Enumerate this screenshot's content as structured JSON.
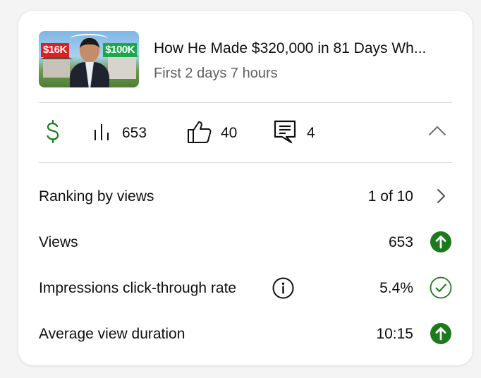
{
  "video": {
    "thumbnail_left_tag": "$16K",
    "thumbnail_right_tag": "$100K",
    "title": "How He Made $320,000 in 81 Days Wh...",
    "subtitle": "First 2 days 7 hours"
  },
  "stats": {
    "revenue_icon": "dollar-icon",
    "views_icon": "bar-chart-icon",
    "views": "653",
    "likes_icon": "thumbs-up-icon",
    "likes": "40",
    "comments_icon": "comment-icon",
    "comments": "4",
    "collapse_icon": "chevron-up-icon"
  },
  "metrics": [
    {
      "label": "Ranking by views",
      "value": "1 of 10",
      "indicator": "chevron-right-icon"
    },
    {
      "label": "Views",
      "value": "653",
      "indicator": "up-arrow-icon"
    },
    {
      "label": "Impressions click-through rate",
      "value": "5.4%",
      "indicator": "check-circle-icon",
      "info_icon": "info-icon"
    },
    {
      "label": "Average view duration",
      "value": "10:15",
      "indicator": "up-arrow-icon"
    }
  ],
  "colors": {
    "accent_green": "#1b7a1b",
    "text_primary": "#0f0f0f",
    "text_secondary": "#606060",
    "divider": "#dcdcdc"
  }
}
